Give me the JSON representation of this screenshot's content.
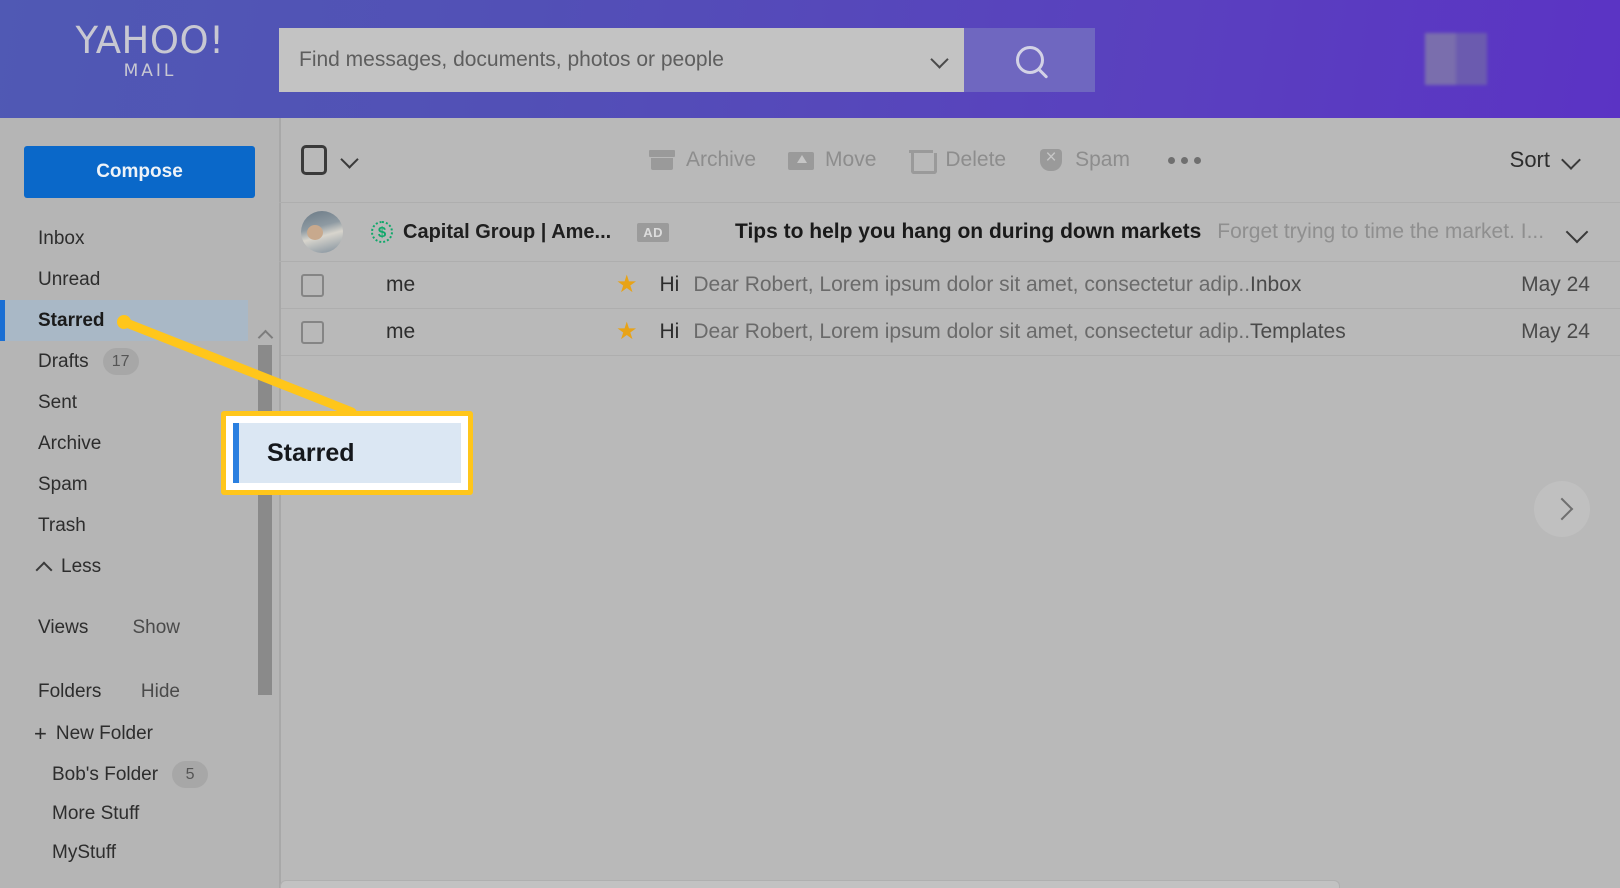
{
  "app": {
    "brand_line1": "YAHOO!",
    "brand_line2": "MAIL",
    "header_gradient_start": "#5059b4",
    "header_gradient_end": "#5b33c4"
  },
  "search": {
    "placeholder": "Find messages, documents, photos or people",
    "value": "",
    "dropdown_icon": "chevron-down-icon",
    "button_icon": "search-icon"
  },
  "sidebar": {
    "compose_label": "Compose",
    "compose_color": "#0a68c9",
    "items": [
      {
        "label": "Inbox",
        "badge": "",
        "active": false
      },
      {
        "label": "Unread",
        "badge": "",
        "active": false
      },
      {
        "label": "Starred",
        "badge": "",
        "active": true
      },
      {
        "label": "Drafts",
        "badge": "17",
        "active": false
      },
      {
        "label": "Sent",
        "badge": "",
        "active": false
      },
      {
        "label": "Archive",
        "badge": "",
        "active": false
      },
      {
        "label": "Spam",
        "badge": "",
        "active": false
      },
      {
        "label": "Trash",
        "badge": "",
        "active": false
      }
    ],
    "less_label": "Less",
    "views": {
      "label": "Views",
      "action": "Show"
    },
    "folders": {
      "label": "Folders",
      "action": "Hide"
    },
    "new_folder_label": "New Folder",
    "folder_items": [
      {
        "label": "Bob's Folder",
        "badge": "5"
      },
      {
        "label": "More Stuff",
        "badge": ""
      },
      {
        "label": "MyStuff",
        "badge": ""
      }
    ],
    "active_accent": "#1a6fd4"
  },
  "toolbar": {
    "select_all": "",
    "actions": [
      {
        "label": "Archive",
        "icon": "archive-icon"
      },
      {
        "label": "Move",
        "icon": "move-folder-icon"
      },
      {
        "label": "Delete",
        "icon": "trash-icon"
      },
      {
        "label": "Spam",
        "icon": "spam-shield-icon"
      }
    ],
    "more_label": "",
    "sort_label": "Sort"
  },
  "ad": {
    "brand": "Capital Group | Ame...",
    "badge": "AD",
    "subject": "Tips to help you hang on during down markets",
    "preview": "Forget trying to time the market. I...",
    "brand_icon": "dollar-sign-icon",
    "expand_icon": "chevron-down-icon"
  },
  "messages": [
    {
      "sender": "me",
      "starred": true,
      "subject": "Hi",
      "preview": "Dear Robert, Lorem ipsum dolor sit amet, consectetur adip...",
      "folder": "Inbox",
      "date": "May 24"
    },
    {
      "sender": "me",
      "starred": true,
      "subject": "Hi",
      "preview": "Dear Robert, Lorem ipsum dolor sit amet, consectetur adip...",
      "folder": "Templates",
      "date": "May 24"
    }
  ],
  "callout": {
    "text": "Starred",
    "border_color": "#ffc61b",
    "inner_bg": "#dbe7f3",
    "accent": "#2a7fe0"
  },
  "star_color": "#e8a317"
}
